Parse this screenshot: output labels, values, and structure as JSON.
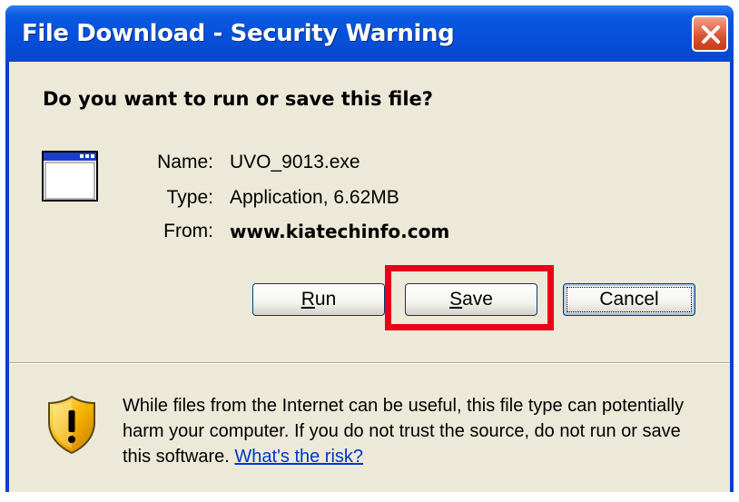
{
  "window": {
    "title": "File Download - Security Warning",
    "close_icon": "close-icon"
  },
  "prompt": {
    "question": "Do you want to run or save this file?"
  },
  "file": {
    "icon": "application-window-icon",
    "name_label": "Name:",
    "name_value": "UVO_9013.exe",
    "type_label": "Type:",
    "type_value": "Application, 6.62MB",
    "from_label": "From:",
    "from_value": "www.kiatechinfo.com"
  },
  "buttons": {
    "run": {
      "mnemonic": "R",
      "rest": "un"
    },
    "save": {
      "mnemonic": "S",
      "rest": "ave"
    },
    "cancel": "Cancel"
  },
  "highlight_color": "#e8001a",
  "warning": {
    "icon": "shield-warning-icon",
    "text": "While files from the Internet can be useful, this file type can potentially harm your computer. If you do not trust the source, do not run or save this software.",
    "link": "What's the risk?"
  }
}
